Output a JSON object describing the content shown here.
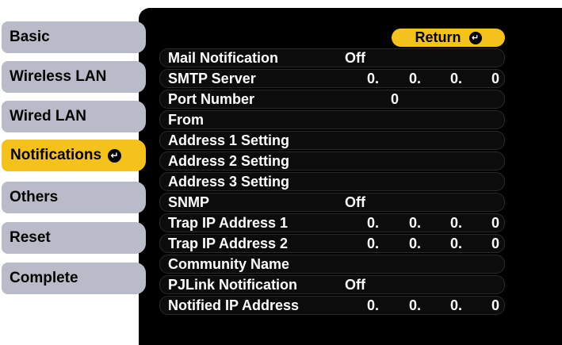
{
  "sidebar": {
    "tabs": [
      {
        "label": "Basic",
        "active": false
      },
      {
        "label": "Wireless LAN",
        "active": false
      },
      {
        "label": "Wired LAN",
        "active": false
      },
      {
        "label": "Notifications",
        "active": true
      },
      {
        "label": "Others",
        "active": false
      },
      {
        "label": "Reset",
        "active": false
      },
      {
        "label": "Complete",
        "active": false
      }
    ],
    "active_tab_icon": "enter-icon"
  },
  "header": {
    "return_label": "Return",
    "return_icon": "enter-icon"
  },
  "settings": [
    {
      "label": "Mail Notification",
      "value": "Off"
    },
    {
      "label": "SMTP Server",
      "ip": [
        "0.",
        "0.",
        "0.",
        "0"
      ]
    },
    {
      "label": "Port Number",
      "value": "0"
    },
    {
      "label": "From"
    },
    {
      "label": "Address 1 Setting"
    },
    {
      "label": "Address 2 Setting"
    },
    {
      "label": "Address 3 Setting"
    },
    {
      "label": "SNMP",
      "value": "Off"
    },
    {
      "label": "Trap IP Address 1",
      "ip": [
        "0.",
        "0.",
        "0.",
        "0"
      ]
    },
    {
      "label": "Trap IP Address 2",
      "ip": [
        "0.",
        "0.",
        "0.",
        "0"
      ]
    },
    {
      "label": "Community Name"
    },
    {
      "label": "PJLink Notification",
      "value": "Off"
    },
    {
      "label": "Notified IP Address",
      "ip": [
        "0.",
        "0.",
        "0.",
        "0"
      ]
    }
  ],
  "colors": {
    "accent": "#f5c21b",
    "tab_inactive": "#b9bcc8",
    "panel": "#000000"
  }
}
